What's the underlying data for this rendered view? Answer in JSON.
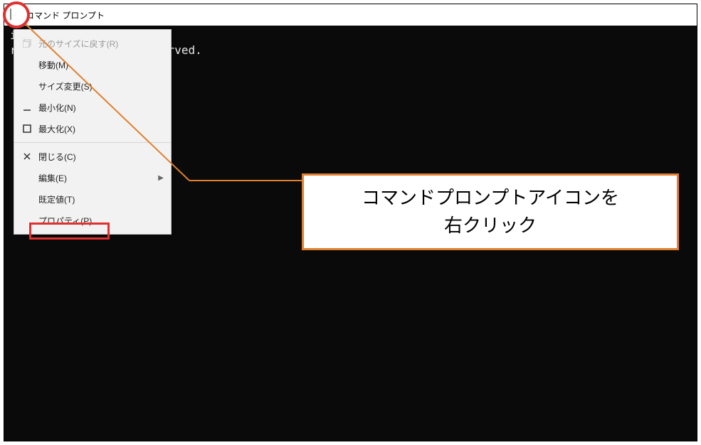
{
  "window": {
    "title": "コマンド プロンプト"
  },
  "terminal": {
    "line1": "ion 10.0.18363.1016]",
    "line2": "ration. All rights reserved."
  },
  "menu": {
    "restore": "元のサイズに戻す(R)",
    "move": "移動(M)",
    "size": "サイズ変更(S)",
    "minimize": "最小化(N)",
    "maximize": "最大化(X)",
    "close": "閉じる(C)",
    "edit": "編集(E)",
    "defaults": "既定値(T)",
    "properties": "プロパティ(P)"
  },
  "callout": {
    "line1": "コマンドプロンプトアイコンを",
    "line2": "右クリック"
  }
}
